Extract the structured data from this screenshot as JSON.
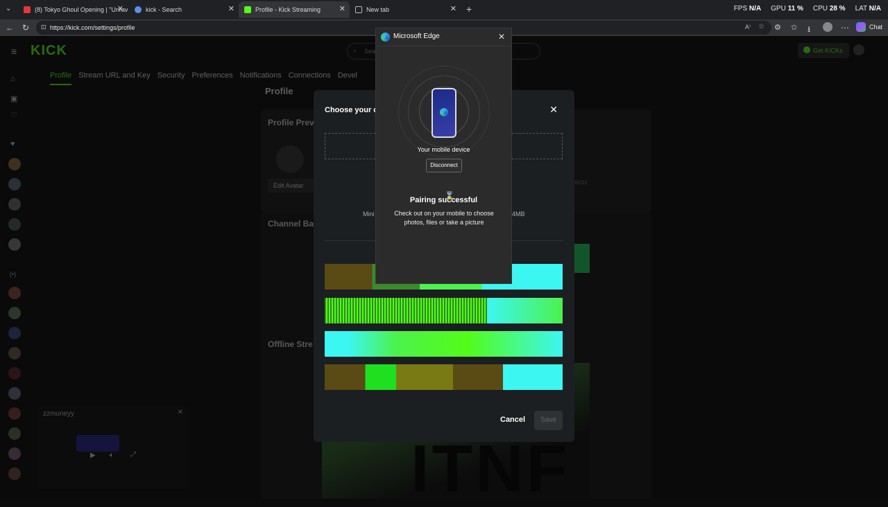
{
  "browser": {
    "tabs": [
      {
        "title": "(8) Tokyo Ghoul Opening | \"Unrav",
        "color": "#e53935"
      },
      {
        "title": "kick - Search",
        "color": "#5f8de8"
      },
      {
        "title": "Profile - Kick Streaming",
        "color": "#53fc18"
      },
      {
        "title": "New tab",
        "color": "#bbbbbb"
      }
    ],
    "url": "https://kick.com/settings/profile",
    "chat_label": "Chat",
    "perf": {
      "fps_label": "FPS",
      "fps": "N/A",
      "gpu_label": "GPU",
      "gpu": "11 %",
      "cpu_label": "CPU",
      "cpu": "28 %",
      "lat_label": "LAT",
      "lat": "N/A"
    }
  },
  "site": {
    "logo": "KICK",
    "search_placeholder": "Search",
    "get_kicks": "Get KICKs",
    "tabs": [
      "Profile",
      "Stream URL and Key",
      "Security",
      "Preferences",
      "Notifications",
      "Connections",
      "Devel"
    ],
    "page_title": "Profile",
    "sections": {
      "profile_preview": "Profile Prev",
      "edit_avatar": "Edit Avatar",
      "channel_banner": "Channel Ba",
      "offline": "Offline Stre",
      "username_partial": "...nezzz"
    },
    "mini_player": {
      "username": "zzmuneyy"
    },
    "banner_text": "ITNF"
  },
  "modal": {
    "title": "Choose your c",
    "min_text": "Mini",
    "size_text": "4MB",
    "cancel": "Cancel",
    "save": "Save"
  },
  "edge_dialog": {
    "title": "Microsoft Edge",
    "device_label": "Your mobile device",
    "disconnect": "Disconnect",
    "status_title": "Pairing successful",
    "status_body": "Check out on your mobile to choose photos, files or take a picture"
  },
  "colors": {
    "accent": "#53fc18",
    "cyan": "#3cf6f2",
    "olive": "#5a4a14"
  }
}
